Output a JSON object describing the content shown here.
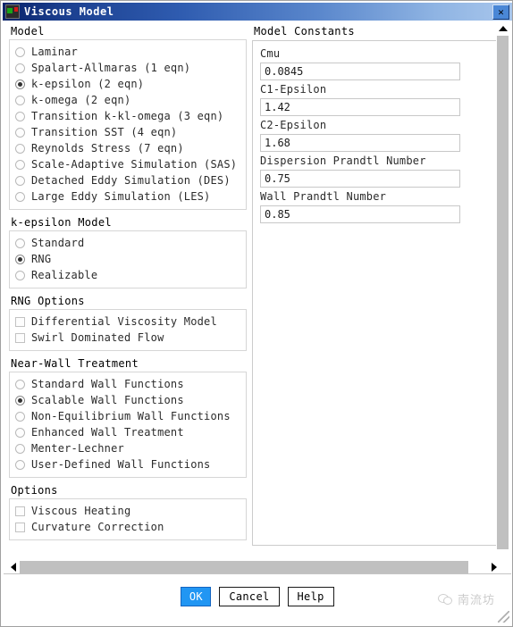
{
  "window": {
    "title": "Viscous Model",
    "icon": "app-icon",
    "close_label": "✕"
  },
  "model_group": {
    "label": "Model",
    "selected": "k-epsilon (2 eqn)",
    "options": [
      {
        "label": "Laminar",
        "checked": false
      },
      {
        "label": "Spalart-Allmaras (1 eqn)",
        "checked": false
      },
      {
        "label": "k-epsilon (2 eqn)",
        "checked": true
      },
      {
        "label": "k-omega (2 eqn)",
        "checked": false
      },
      {
        "label": "Transition k-kl-omega (3 eqn)",
        "checked": false
      },
      {
        "label": "Transition SST (4 eqn)",
        "checked": false
      },
      {
        "label": "Reynolds Stress (7 eqn)",
        "checked": false
      },
      {
        "label": "Scale-Adaptive Simulation (SAS)",
        "checked": false
      },
      {
        "label": "Detached Eddy Simulation (DES)",
        "checked": false
      },
      {
        "label": "Large Eddy Simulation (LES)",
        "checked": false
      }
    ]
  },
  "kepsilon_group": {
    "label": "k-epsilon Model",
    "selected": "RNG",
    "options": [
      {
        "label": "Standard",
        "checked": false
      },
      {
        "label": "RNG",
        "checked": true
      },
      {
        "label": "Realizable",
        "checked": false
      }
    ]
  },
  "rng_options_group": {
    "label": "RNG Options",
    "options": [
      {
        "label": "Differential Viscosity Model",
        "checked": false
      },
      {
        "label": "Swirl Dominated Flow",
        "checked": false
      }
    ]
  },
  "near_wall_group": {
    "label": "Near-Wall Treatment",
    "selected": "Scalable Wall Functions",
    "options": [
      {
        "label": "Standard Wall Functions",
        "checked": false
      },
      {
        "label": "Scalable Wall Functions",
        "checked": true
      },
      {
        "label": "Non-Equilibrium Wall Functions",
        "checked": false
      },
      {
        "label": "Enhanced Wall Treatment",
        "checked": false
      },
      {
        "label": "Menter-Lechner",
        "checked": false
      },
      {
        "label": "User-Defined Wall Functions",
        "checked": false
      }
    ]
  },
  "options_group": {
    "label": "Options",
    "options": [
      {
        "label": "Viscous Heating",
        "checked": false
      },
      {
        "label": "Curvature Correction",
        "checked": false
      }
    ]
  },
  "model_constants": {
    "label": "Model Constants",
    "fields": [
      {
        "label": "Cmu",
        "value": "0.0845"
      },
      {
        "label": "C1-Epsilon",
        "value": "1.42"
      },
      {
        "label": "C2-Epsilon",
        "value": "1.68"
      },
      {
        "label": "Dispersion Prandtl Number",
        "value": "0.75"
      },
      {
        "label": "Wall Prandtl Number",
        "value": "0.85"
      }
    ]
  },
  "footer": {
    "ok_label": "OK",
    "cancel_label": "Cancel",
    "help_label": "Help",
    "watermark_text": "南流坊"
  },
  "colors": {
    "titlebar_dark": "#0a246a",
    "titlebar_light": "#a8c6ec",
    "primary_button": "#2196f3",
    "scrollbar_thumb": "#c0c0c0"
  }
}
